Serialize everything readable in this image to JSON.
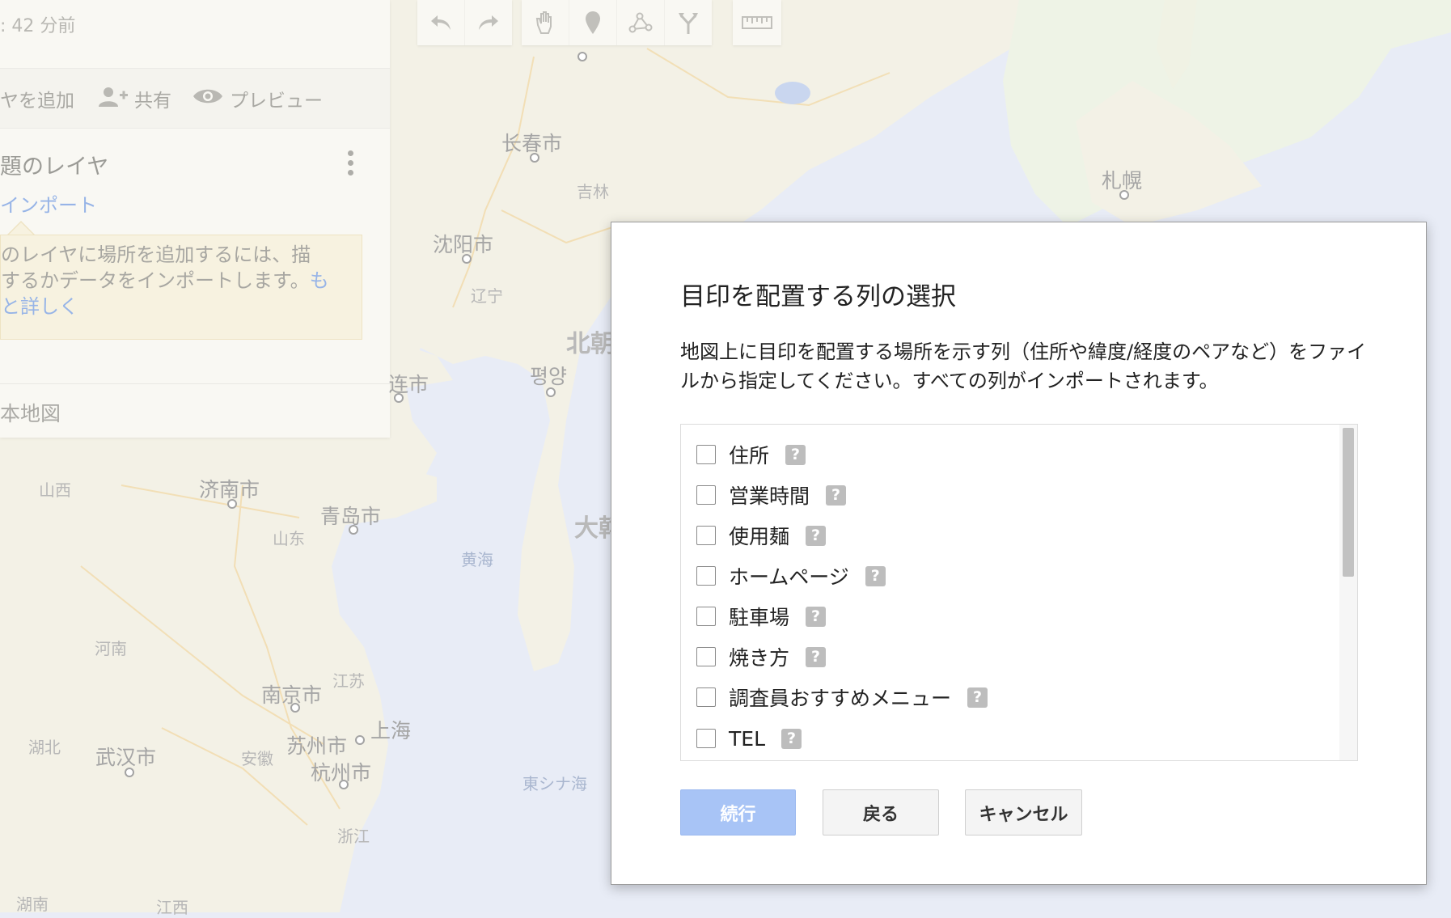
{
  "map": {
    "labels": [
      {
        "text": "长春市",
        "kind": "city"
      },
      {
        "text": "吉林",
        "kind": "prov"
      },
      {
        "text": "沈阳市",
        "kind": "city"
      },
      {
        "text": "辽宁",
        "kind": "prov"
      },
      {
        "text": "北朝",
        "kind": "country"
      },
      {
        "text": "평양",
        "kind": "city"
      },
      {
        "text": "连市",
        "kind": "city"
      },
      {
        "text": "札幌",
        "kind": "city"
      },
      {
        "text": "山西",
        "kind": "prov"
      },
      {
        "text": "济南市",
        "kind": "city"
      },
      {
        "text": "青岛市",
        "kind": "city"
      },
      {
        "text": "山东",
        "kind": "prov"
      },
      {
        "text": "大韓",
        "kind": "country"
      },
      {
        "text": "黄海",
        "kind": "sea"
      },
      {
        "text": "河南",
        "kind": "prov"
      },
      {
        "text": "南京市",
        "kind": "city"
      },
      {
        "text": "江苏",
        "kind": "prov"
      },
      {
        "text": "上海",
        "kind": "city"
      },
      {
        "text": "湖北",
        "kind": "prov"
      },
      {
        "text": "武汉市",
        "kind": "city"
      },
      {
        "text": "安徽",
        "kind": "prov"
      },
      {
        "text": "苏州市",
        "kind": "city"
      },
      {
        "text": "杭州市",
        "kind": "city"
      },
      {
        "text": "東シナ海",
        "kind": "sea"
      },
      {
        "text": "浙江",
        "kind": "prov"
      },
      {
        "text": "湖南",
        "kind": "prov"
      },
      {
        "text": "江西",
        "kind": "prov"
      }
    ]
  },
  "panel": {
    "saved_text": ": 42 分前",
    "add_layer": "ヤを追加",
    "share": "共有",
    "preview": "プレビュー",
    "layer_title": "題のレイヤ",
    "import_link": "インポート",
    "hint_line1": "のレイヤに場所を追加するには、描",
    "hint_line2": "するかデータをインポートします。",
    "hint_link_a": "も",
    "hint_link_b": "と詳しく",
    "basemap": "本地図"
  },
  "toolbar": {
    "icons": [
      "undo-icon",
      "redo-icon",
      "hand-icon",
      "marker-icon",
      "draw-line-icon",
      "directions-icon",
      "ruler-icon"
    ]
  },
  "dialog": {
    "title": "目印を配置する列の選択",
    "description": "地図上に目印を配置する場所を示す列（住所や緯度/経度のペアなど）をファイルから指定してください。すべての列がインポートされます。",
    "columns": [
      {
        "label": "住所",
        "checked": false
      },
      {
        "label": "営業時間",
        "checked": false
      },
      {
        "label": "使用麺",
        "checked": false
      },
      {
        "label": "ホームページ",
        "checked": false
      },
      {
        "label": "駐車場",
        "checked": false
      },
      {
        "label": "焼き方",
        "checked": false
      },
      {
        "label": "調査員おすすめメニュー",
        "checked": false
      },
      {
        "label": "TEL",
        "checked": false
      }
    ],
    "help_glyph": "?",
    "continue_label": "続行",
    "back_label": "戻る",
    "cancel_label": "キャンセル"
  }
}
